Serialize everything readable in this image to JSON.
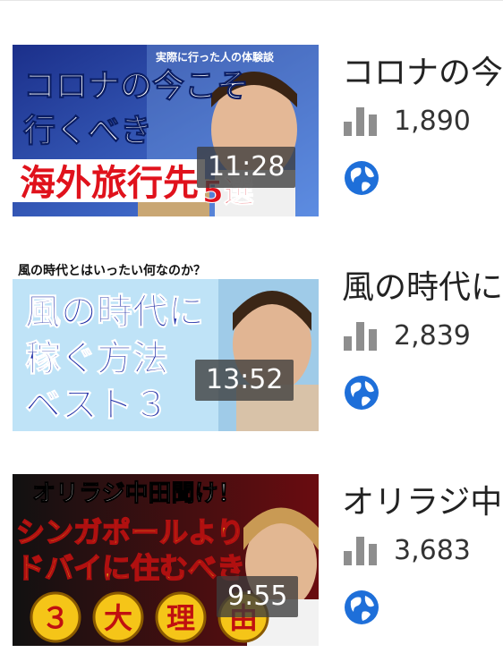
{
  "videos": [
    {
      "title": "コロナの今",
      "views": "1,890",
      "duration": "11:28",
      "thumbnail": {
        "small": "実際に行った人の体験談",
        "line1": "コロナの今こそ",
        "line2": "行くべき",
        "line3": "海外旅行先",
        "badge": "5選"
      }
    },
    {
      "title": "風の時代に",
      "views": "2,839",
      "duration": "13:52",
      "thumbnail": {
        "small": "風の時代とはいったい何なのか？",
        "line1": "風の時代に",
        "line2": "稼ぐ方法",
        "line3": "ベスト３"
      }
    },
    {
      "title": "オリラジ中",
      "views": "3,683",
      "duration": "9:55",
      "thumbnail": {
        "line1": "オリラジ中田聞け！",
        "line2": "シンガポールより",
        "line3": "ドバイに住むべき",
        "badges": [
          "３",
          "大",
          "理",
          "由"
        ]
      }
    }
  ],
  "icons": {
    "views": "bar-chart-icon",
    "visibility": "globe-icon"
  },
  "colors": {
    "icon_gray": "#8e8e8e",
    "globe_blue": "#1e6fd9",
    "text": "#222222"
  }
}
